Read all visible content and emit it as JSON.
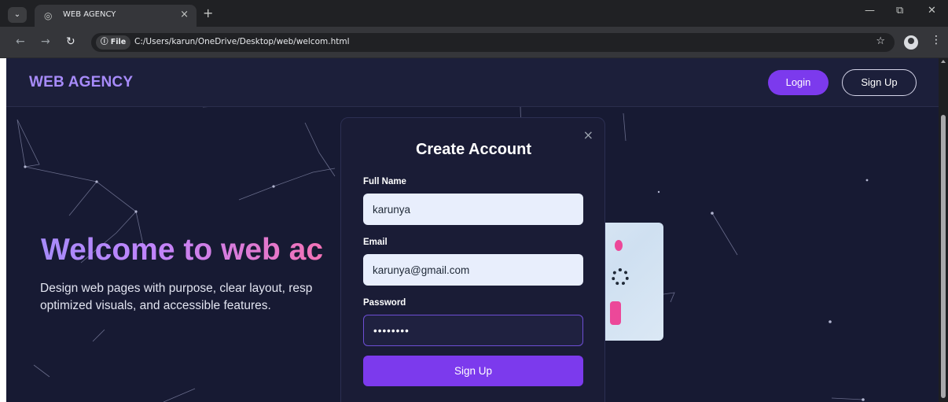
{
  "browser": {
    "tab_title": "WEB AGENCY",
    "tab_close": "×",
    "new_tab": "+",
    "site_info": "ⓘ File",
    "url": "C:/Users/karun/OneDrive/Desktop/web/welcom.html",
    "window_minimize": "—",
    "window_restore": "⧉",
    "window_close": "✕"
  },
  "header": {
    "brand": "WEB AGENCY",
    "login_label": "Login",
    "signup_label": "Sign Up"
  },
  "hero": {
    "title": "Welcome to web ac",
    "text_line1": "Design web pages with purpose, clear layout, resp",
    "text_line2": "optimized visuals, and accessible features."
  },
  "modal": {
    "title": "Create Account",
    "close_label": "×",
    "full_name_label": "Full Name",
    "full_name_value": "karunya",
    "email_label": "Email",
    "email_value": "karunya@gmail.com",
    "password_label": "Password",
    "password_value": "••••••••",
    "submit_label": "Sign Up"
  },
  "colors": {
    "page_bg": "#171a33",
    "accent": "#7c3aed",
    "brand": "#a78bfa",
    "input_bg": "#e8eefc"
  },
  "icons": {
    "tab_search": "chevron-down-icon",
    "favicon": "globe-icon",
    "back": "arrow-left-icon",
    "forward": "arrow-right-icon",
    "reload": "reload-icon",
    "bookmark": "star-icon",
    "profile": "profile-icon",
    "menu": "kebab-menu-icon"
  }
}
